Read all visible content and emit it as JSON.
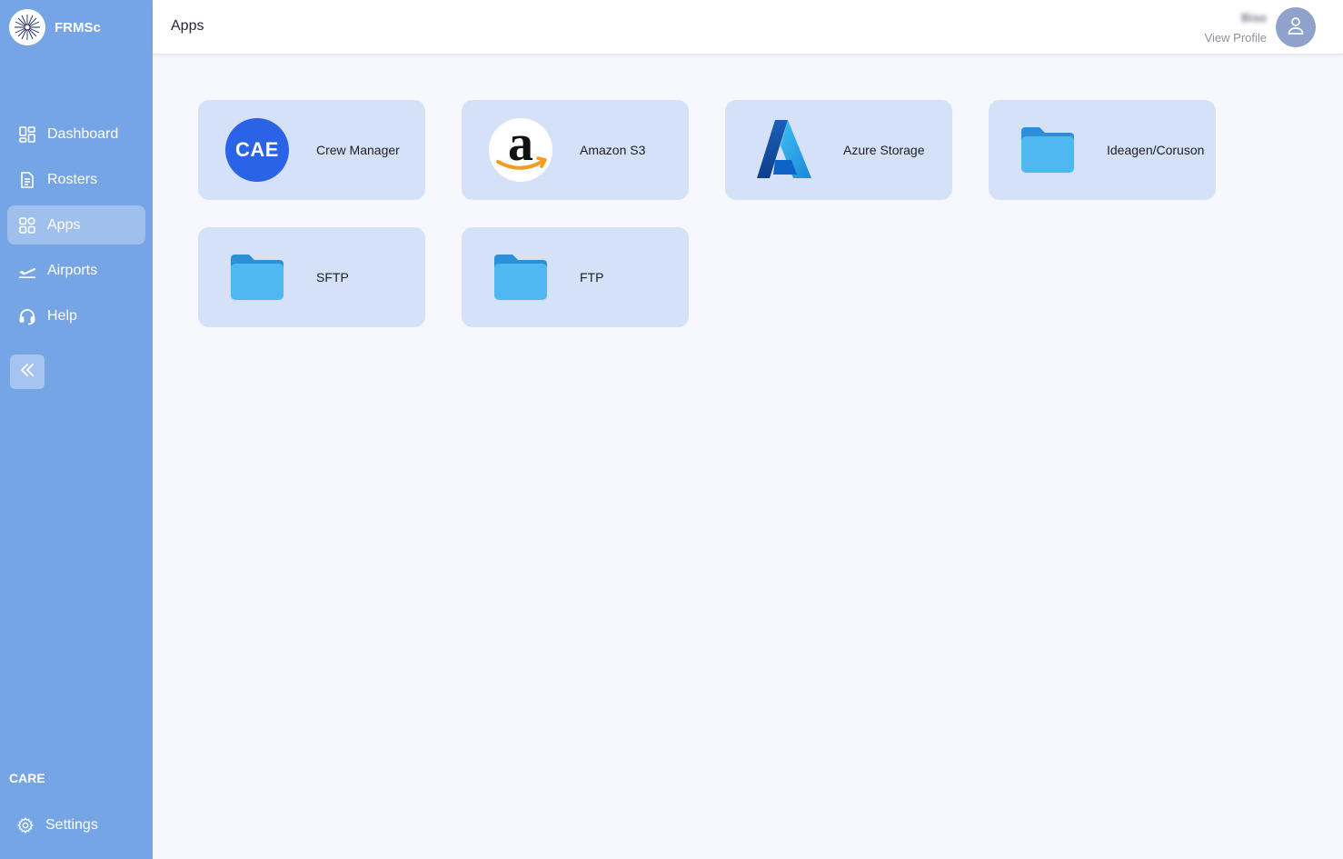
{
  "brand": {
    "name": "FRMSc"
  },
  "sidebar": {
    "items": [
      {
        "label": "Dashboard",
        "icon": "dashboard-icon",
        "active": false
      },
      {
        "label": "Rosters",
        "icon": "document-icon",
        "active": false
      },
      {
        "label": "Apps",
        "icon": "apps-grid-icon",
        "active": true
      },
      {
        "label": "Airports",
        "icon": "airplane-takeoff-icon",
        "active": false
      },
      {
        "label": "Help",
        "icon": "headset-icon",
        "active": false
      }
    ],
    "org_label": "CARE",
    "settings_label": "Settings"
  },
  "header": {
    "title": "Apps",
    "user_name": "Biso",
    "view_profile": "View Profile"
  },
  "apps": [
    {
      "label": "Crew Manager",
      "logo": "cae-logo",
      "logo_text": "CAE"
    },
    {
      "label": "Amazon S3",
      "logo": "amazon-logo",
      "logo_text": "a"
    },
    {
      "label": "Azure Storage",
      "logo": "azure-logo"
    },
    {
      "label": "Ideagen/Coruson",
      "logo": "folder-icon"
    },
    {
      "label": "SFTP",
      "logo": "folder-icon"
    },
    {
      "label": "FTP",
      "logo": "folder-icon"
    }
  ],
  "colors": {
    "sidebar": "#76a5e6",
    "card": "#d5e1f6",
    "cae_blue": "#2b63e6",
    "folder_blue": "#4fb8f0",
    "amazon_orange": "#f39c1f"
  }
}
